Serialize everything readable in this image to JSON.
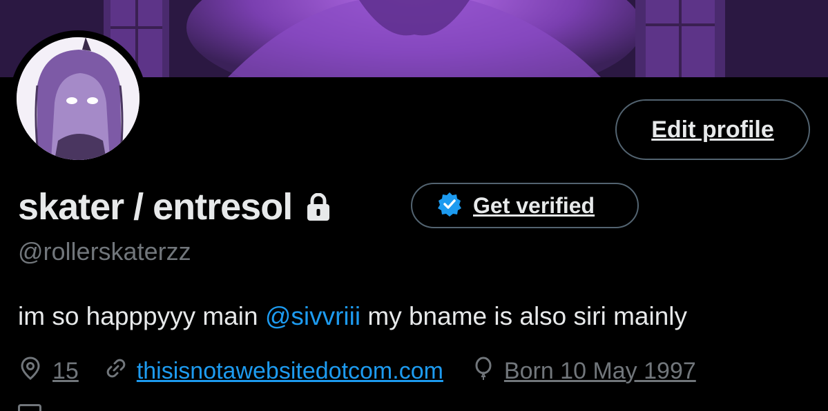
{
  "profile": {
    "display_name": "skater / entresol",
    "handle": "@rollerskaterzz",
    "bio_before": "im so happpyyy main ",
    "bio_mention": "@sivvriii",
    "bio_after": " my bname is also siri mainly",
    "location": "15",
    "website": "thisisnotawebsitedotcom.com",
    "birthday": "Born 10 May 1997"
  },
  "buttons": {
    "edit_profile": "Edit profile",
    "get_verified": "Get verified"
  },
  "icons": {
    "lock": "lock-icon",
    "verified": "verified-badge-icon",
    "location": "location-pin-icon",
    "link": "link-icon",
    "birthday": "balloon-icon",
    "calendar": "calendar-icon"
  },
  "colors": {
    "background": "#000000",
    "text": "#e7e9ea",
    "secondary": "#71767b",
    "accent": "#1d9bf0",
    "border": "#536471"
  }
}
